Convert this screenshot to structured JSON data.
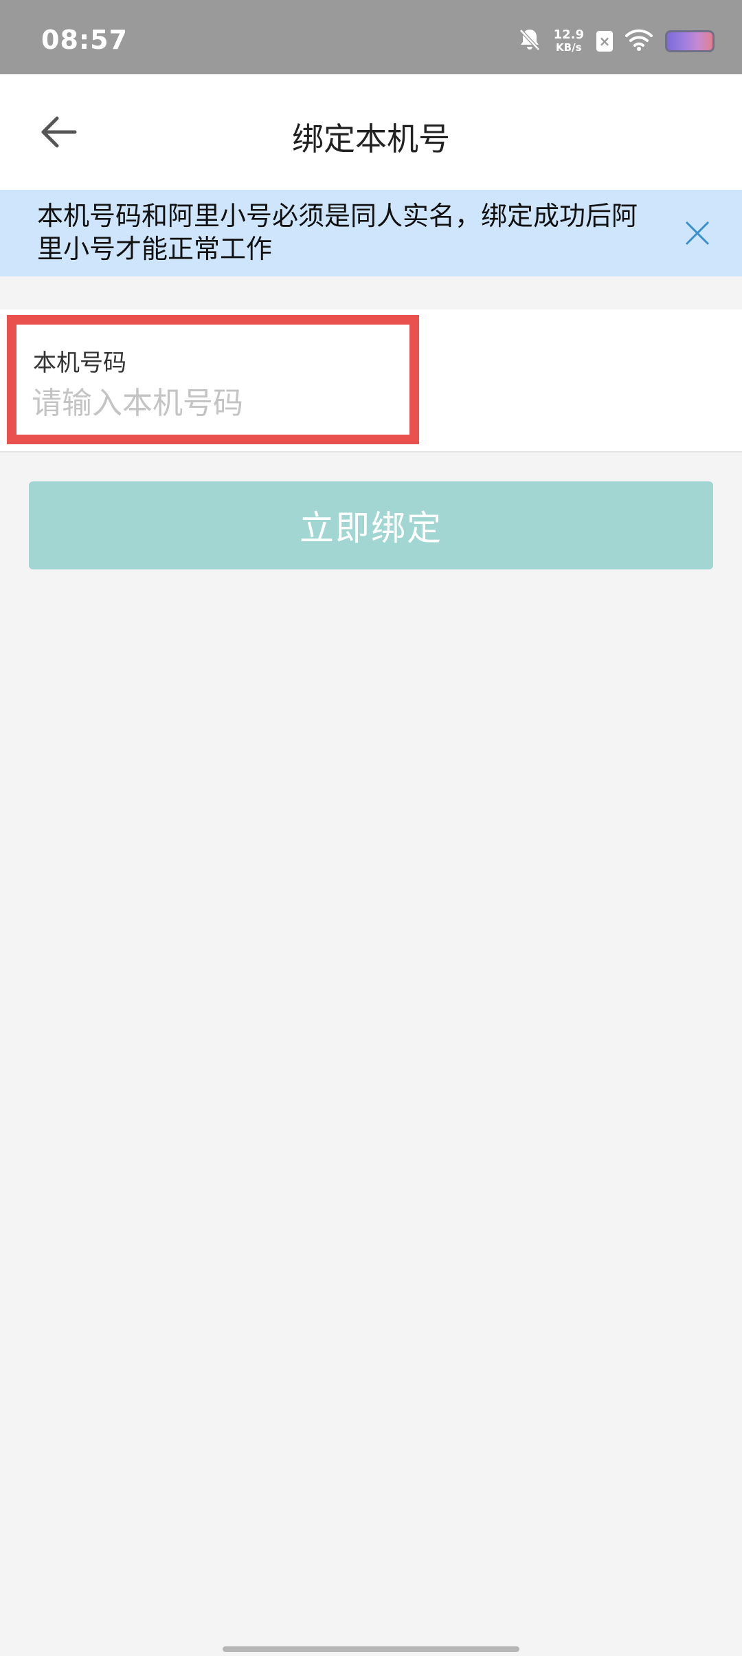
{
  "status_bar": {
    "time": "08:57",
    "net_speed_value": "12.9",
    "net_speed_unit": "KB/s",
    "sim_badge": "×",
    "icons": [
      "bell-muted-icon",
      "sim-x-icon",
      "wifi-icon",
      "battery-icon"
    ]
  },
  "header": {
    "title": "绑定本机号",
    "back_icon": "back-arrow-icon"
  },
  "notice": {
    "text": "本机号码和阿里小号必须是同人实名，绑定成功后阿里小号才能正常工作",
    "close_icon": "close-icon"
  },
  "form": {
    "phone_label": "本机号码",
    "phone_value": "",
    "phone_placeholder": "请输入本机号码"
  },
  "actions": {
    "bind_label": "立即绑定"
  },
  "colors": {
    "status_bar_bg": "#9a9a9a",
    "notice_bg": "#cfe5fb",
    "highlight_border": "#e8514d",
    "button_bg": "#a2d6d2",
    "close_icon": "#3a8fcf"
  }
}
